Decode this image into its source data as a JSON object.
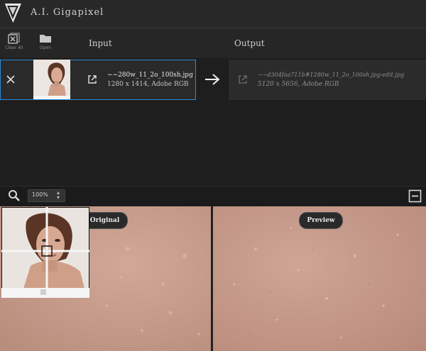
{
  "app": {
    "title": "A.I. Gigapixel"
  },
  "toolbar": {
    "clear_all_label": "Clear All",
    "open_label": "Open",
    "input_header": "Input",
    "output_header": "Output"
  },
  "input_file": {
    "name": "~~280w_11_2o_100sh.jpg",
    "meta": "1280 x 1414, Adobe RGB"
  },
  "output_file": {
    "name": "~~d304faa711b#1280w_11_2o_100sh.jpg-edit.jpg",
    "meta": "5120 x 5656, Adobe RGB"
  },
  "viewer": {
    "zoom_value": "100%",
    "original_label": "Original",
    "preview_label": "Preview"
  },
  "colors": {
    "accent": "#2d8ad8",
    "skin": "#c9a090",
    "background": "#1e1e1e"
  }
}
